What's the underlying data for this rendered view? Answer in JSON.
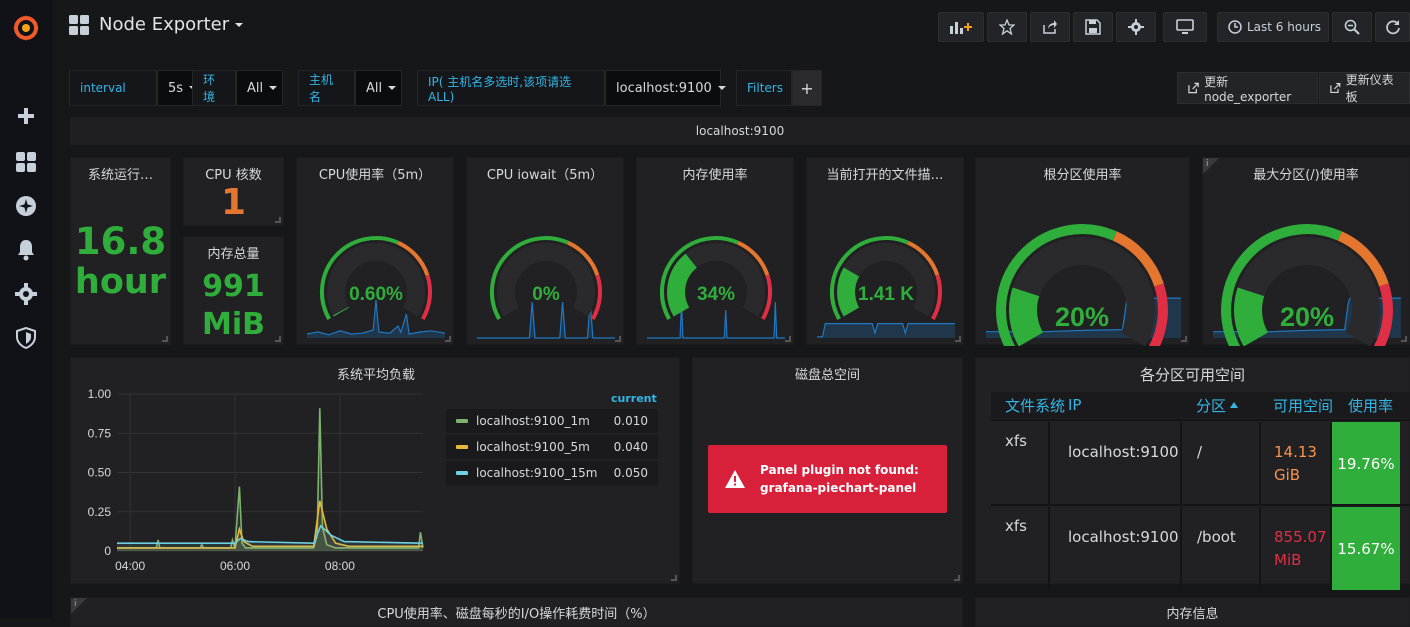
{
  "topbar": {
    "title": "Node Exporter",
    "time_range": "Last 6 hours"
  },
  "variables": {
    "interval_label": "interval",
    "interval_value": "5s",
    "env_label": "环境",
    "env_value": "All",
    "host_label": "主机名",
    "host_value": "All",
    "ip_label": "IP( 主机名多选时,该项请选ALL)",
    "ip_value": "localhost:9100",
    "filters_label": "Filters",
    "filters_add": "+",
    "link1": "更新node_exporter",
    "link2": "更新仪表板"
  },
  "row_header": "localhost:9100",
  "stats": {
    "uptime": {
      "title": "系统运行…",
      "value": "16.8",
      "unit": "hour"
    },
    "cpu_cores": {
      "title": "CPU 核数",
      "value": "1"
    },
    "mem_total": {
      "title": "内存总量",
      "value": "991",
      "unit": "MiB"
    }
  },
  "gauges": [
    {
      "title": "CPU使用率（5m）",
      "value": "0.60%",
      "level": 0.006
    },
    {
      "title": "CPU iowait（5m）",
      "value": "0%",
      "level": 0.0
    },
    {
      "title": "内存使用率",
      "value": "34%",
      "level": 0.34
    },
    {
      "title": "当前打开的文件描…",
      "value": "1.41 K",
      "level": 0.25
    },
    {
      "title": "根分区使用率",
      "value": "20%",
      "level": 0.2
    },
    {
      "title": "最大分区(/)使用率",
      "value": "20%",
      "level": 0.2
    }
  ],
  "info_marker": "i",
  "load_panel": {
    "title": "系统平均负载",
    "legend_header": "current",
    "legend": [
      {
        "name": "localhost:9100_1m",
        "value": "0.010",
        "color": "#7eb26d"
      },
      {
        "name": "localhost:9100_5m",
        "value": "0.040",
        "color": "#eab839"
      },
      {
        "name": "localhost:9100_15m",
        "value": "0.050",
        "color": "#6ed0e0"
      }
    ]
  },
  "chart_data": {
    "type": "line",
    "title": "系统平均负载",
    "x_ticks": [
      "04:00",
      "06:00",
      "08:00"
    ],
    "y_ticks": [
      "0",
      "0.25",
      "0.50",
      "0.75",
      "1.00"
    ],
    "ylim": [
      0,
      1.0
    ],
    "xlim": [
      "03:45",
      "09:35"
    ],
    "grid": true,
    "legend_position": "right",
    "series": [
      {
        "name": "localhost:9100_1m",
        "color": "#7eb26d",
        "points": [
          [
            "03:45",
            0.02
          ],
          [
            "04:30",
            0.02
          ],
          [
            "04:32",
            0.07
          ],
          [
            "04:34",
            0.02
          ],
          [
            "05:20",
            0.02
          ],
          [
            "05:22",
            0.04
          ],
          [
            "05:24",
            0.02
          ],
          [
            "05:55",
            0.02
          ],
          [
            "05:57",
            0.07
          ],
          [
            "06:00",
            0.02
          ],
          [
            "06:05",
            0.41
          ],
          [
            "06:08",
            0.05
          ],
          [
            "06:12",
            0.02
          ],
          [
            "07:30",
            0.02
          ],
          [
            "07:34",
            0.1
          ],
          [
            "07:37",
            0.91
          ],
          [
            "07:40",
            0.15
          ],
          [
            "07:45",
            0.04
          ],
          [
            "07:55",
            0.02
          ],
          [
            "09:30",
            0.02
          ],
          [
            "09:32",
            0.12
          ],
          [
            "09:35",
            0.02
          ]
        ]
      },
      {
        "name": "localhost:9100_5m",
        "color": "#eab839",
        "points": [
          [
            "03:45",
            0.02
          ],
          [
            "06:00",
            0.02
          ],
          [
            "06:05",
            0.14
          ],
          [
            "06:10",
            0.06
          ],
          [
            "06:20",
            0.03
          ],
          [
            "07:30",
            0.03
          ],
          [
            "07:37",
            0.32
          ],
          [
            "07:45",
            0.14
          ],
          [
            "07:55",
            0.05
          ],
          [
            "08:10",
            0.03
          ],
          [
            "09:35",
            0.03
          ]
        ]
      },
      {
        "name": "localhost:9100_15m",
        "color": "#6ed0e0",
        "points": [
          [
            "03:45",
            0.05
          ],
          [
            "06:00",
            0.05
          ],
          [
            "06:06",
            0.08
          ],
          [
            "06:15",
            0.06
          ],
          [
            "07:30",
            0.05
          ],
          [
            "07:38",
            0.16
          ],
          [
            "07:50",
            0.1
          ],
          [
            "08:05",
            0.06
          ],
          [
            "09:35",
            0.05
          ]
        ]
      }
    ]
  },
  "disk_panel": {
    "title": "磁盘总空间",
    "error_line1": "Panel plugin not found:",
    "error_line2": "grafana-piechart-panel"
  },
  "partition_table": {
    "title": "各分区可用空间",
    "headers": [
      "文件系统",
      "IP",
      "分区",
      "可用空间",
      "使用率"
    ],
    "rows": [
      {
        "fs": "xfs",
        "ip": "localhost:9100",
        "mount": "/",
        "avail_num": "14.13",
        "avail_unit": "GiB",
        "avail_color": "#f9934e",
        "usage": "19.76%"
      },
      {
        "fs": "xfs",
        "ip": "localhost:9100",
        "mount": "/boot",
        "avail_num": "855.07",
        "avail_unit": "MiB",
        "avail_color": "#e02f44",
        "usage": "15.67%"
      }
    ]
  },
  "bottom_panels": [
    {
      "title": "CPU使用率、磁盘每秒的I/O操作耗费时间（%）"
    },
    {
      "title": "内存信息"
    }
  ],
  "colors": {
    "accent_blue": "#33b5e5",
    "green": "#2fae3b",
    "orange": "#e5762f",
    "red": "#e02f44",
    "spark_blue": "#1f78c1"
  }
}
